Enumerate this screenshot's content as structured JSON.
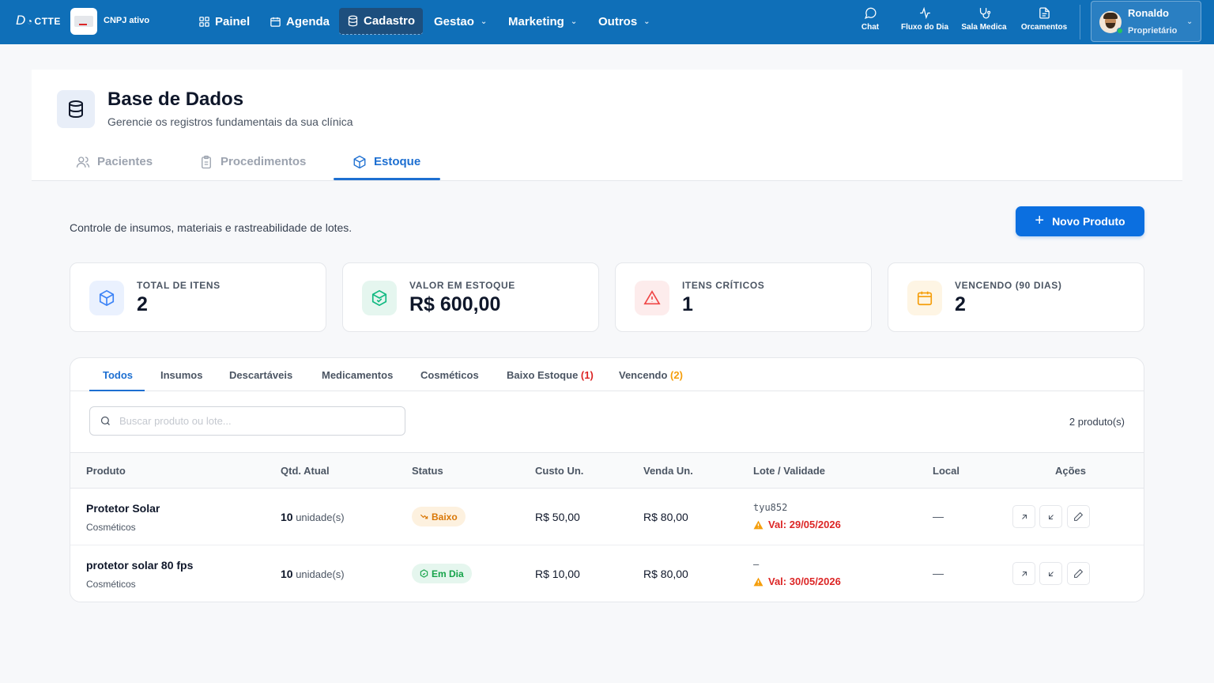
{
  "nav": {
    "logo_main": "D",
    "logo_sub": "CTTE",
    "cnpj_label": "CNPJ ativo",
    "items": [
      {
        "label": "Painel"
      },
      {
        "label": "Agenda"
      },
      {
        "label": "Cadastro"
      },
      {
        "label": "Gestao"
      },
      {
        "label": "Marketing"
      },
      {
        "label": "Outros"
      }
    ],
    "quick": [
      {
        "label": "Chat",
        "icon": "chat-icon"
      },
      {
        "label": "Fluxo do Dia",
        "icon": "activity-icon"
      },
      {
        "label": "Sala Medica",
        "icon": "stethoscope-icon"
      },
      {
        "label": "Orcamentos",
        "icon": "document-icon"
      }
    ],
    "user": {
      "name": "Ronaldo",
      "role": "Proprietário"
    }
  },
  "header": {
    "title": "Base de Dados",
    "subtitle": "Gerencie os registros fundamentais da sua clínica",
    "tabs": [
      {
        "label": "Pacientes"
      },
      {
        "label": "Procedimentos"
      },
      {
        "label": "Estoque"
      }
    ]
  },
  "section": {
    "description": "Controle de insumos, materiais e rastreabilidade de lotes.",
    "new_button": "Novo Produto"
  },
  "stats": [
    {
      "label": "TOTAL DE ITENS",
      "value": "2",
      "color": "#3b82f6"
    },
    {
      "label": "VALOR EM ESTOQUE",
      "value": "R$ 600,00",
      "color": "#10b981"
    },
    {
      "label": "ITENS CRÍTICOS",
      "value": "1",
      "color": "#ef4444"
    },
    {
      "label": "VENCENDO (90 DIAS)",
      "value": "2",
      "color": "#f59e0b"
    }
  ],
  "filters": {
    "tabs": [
      {
        "label": "Todos",
        "count": ""
      },
      {
        "label": "Insumos",
        "count": ""
      },
      {
        "label": "Descartáveis",
        "count": ""
      },
      {
        "label": "Medicamentos",
        "count": ""
      },
      {
        "label": "Cosméticos",
        "count": ""
      },
      {
        "label": "Baixo Estoque",
        "count": "(1)"
      },
      {
        "label": "Vencendo",
        "count": "(2)"
      }
    ],
    "search_placeholder": "Buscar produto ou lote...",
    "count_text": "2 produto(s)"
  },
  "table": {
    "columns": [
      "Produto",
      "Qtd. Atual",
      "Status",
      "Custo Un.",
      "Venda Un.",
      "Lote / Validade",
      "Local",
      "Ações"
    ],
    "rows": [
      {
        "name": "Protetor Solar",
        "category": "Cosméticos",
        "qty": "10",
        "unit": "unidade(s)",
        "status": "Baixo",
        "cost": "R$ 50,00",
        "price": "R$ 80,00",
        "lot": "tyu852",
        "validity": "Val: 29/05/2026",
        "local": "—"
      },
      {
        "name": "protetor solar 80 fps",
        "category": "Cosméticos",
        "qty": "10",
        "unit": "unidade(s)",
        "status": "Em Dia",
        "cost": "R$ 10,00",
        "price": "R$ 80,00",
        "lot": "–",
        "validity": "Val: 30/05/2026",
        "local": "—"
      }
    ]
  },
  "colors": {
    "brand": "#0f6fb8",
    "accent": "#1d6fd1",
    "danger": "#dc2626",
    "warning": "#d97706",
    "success": "#16a34a"
  }
}
